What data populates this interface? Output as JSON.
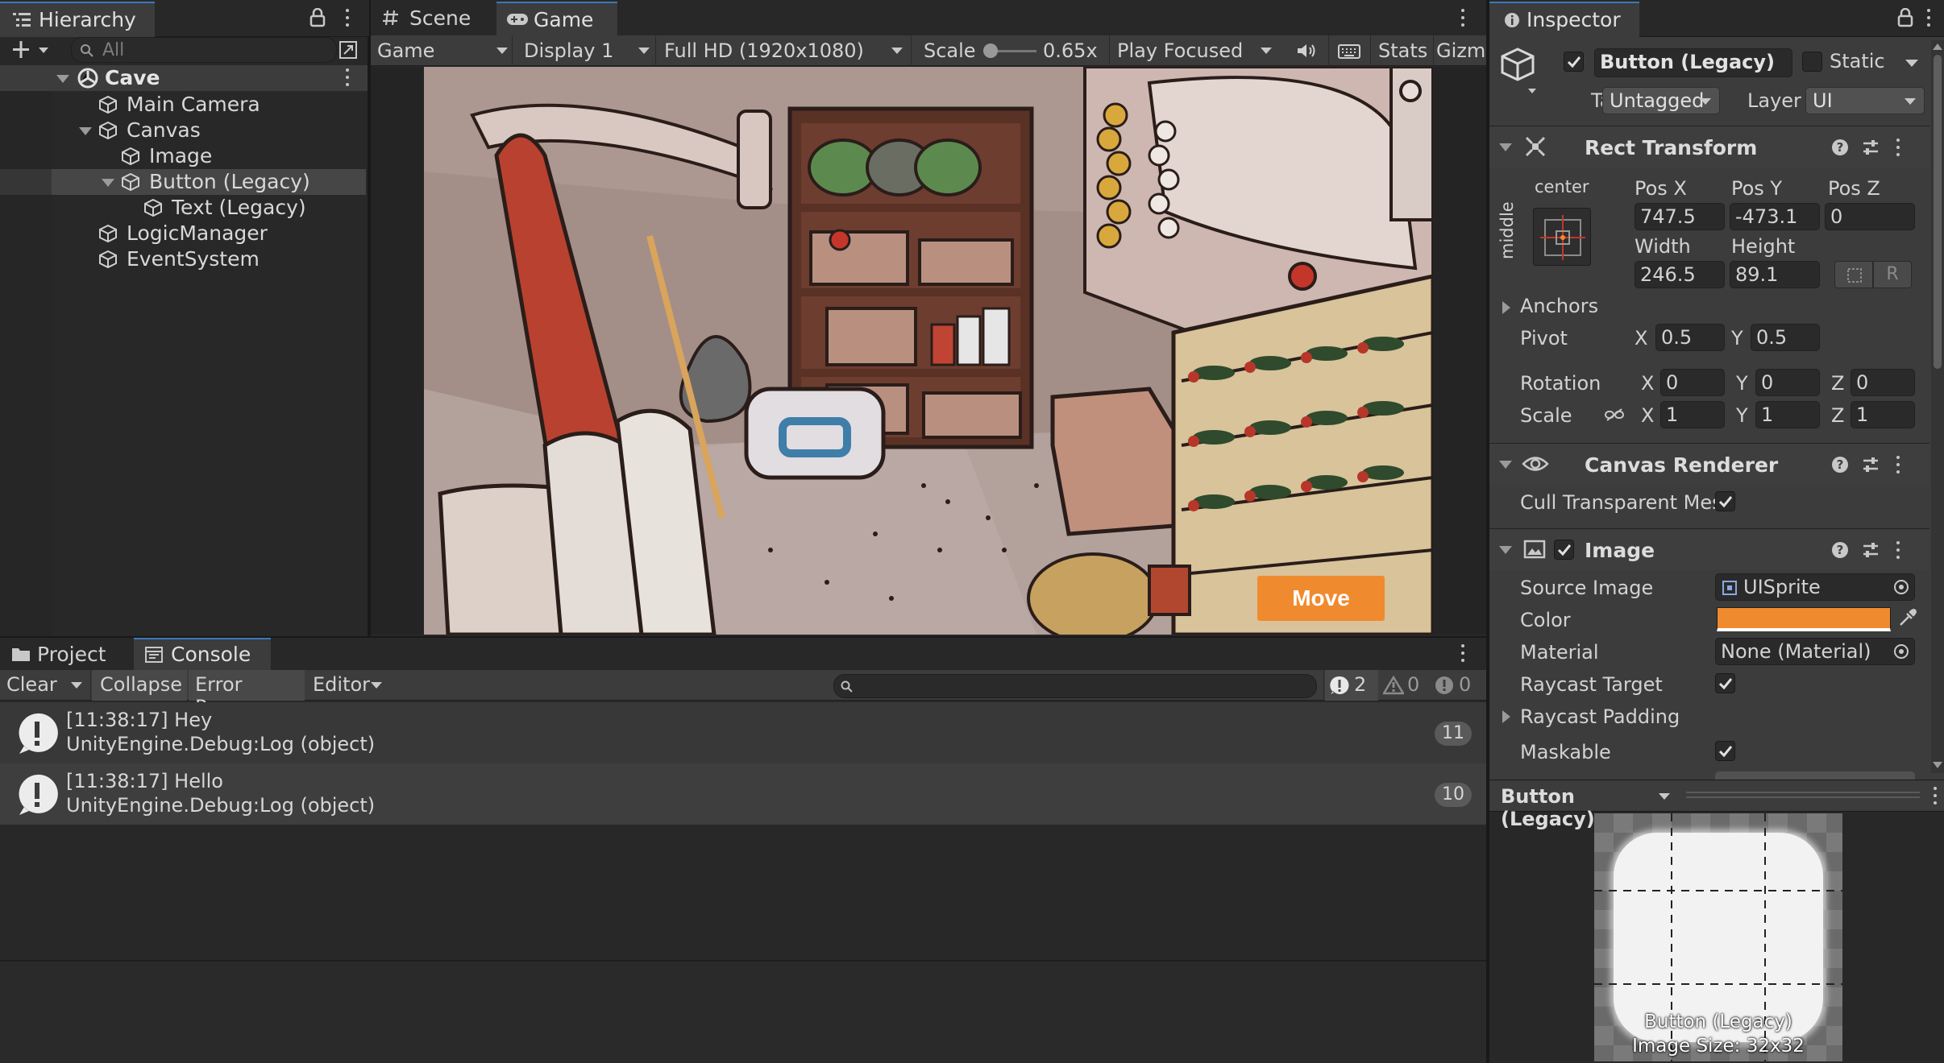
{
  "hierarchy": {
    "tab": "Hierarchy",
    "search_placeholder": "All",
    "scene": "Cave",
    "items": [
      {
        "label": "Main Camera"
      },
      {
        "label": "Canvas"
      },
      {
        "label": "Image"
      },
      {
        "label": "Button (Legacy)"
      },
      {
        "label": "Text (Legacy)"
      },
      {
        "label": "LogicManager"
      },
      {
        "label": "EventSystem"
      }
    ]
  },
  "view_tabs": {
    "scene": "Scene",
    "game": "Game"
  },
  "game_toolbar": {
    "view": "Game",
    "display": "Display 1",
    "resolution": "Full HD (1920x1080)",
    "scale_label": "Scale",
    "scale_value": "0.65x",
    "play_mode": "Play Focused",
    "stats": "Stats",
    "gizmos": "Gizm"
  },
  "game_view": {
    "button_label": "Move",
    "button_color": "#f08a2e"
  },
  "bottom_tabs": {
    "project": "Project",
    "console": "Console"
  },
  "console": {
    "clear": "Clear",
    "collapse": "Collapse",
    "error_pause": "Error Pause",
    "editor": "Editor",
    "count_info": "2",
    "count_warn": "0",
    "count_err": "0",
    "logs": [
      {
        "line1": "[11:38:17] Hey",
        "line2": "UnityEngine.Debug:Log (object)",
        "count": "11"
      },
      {
        "line1": "[11:38:17] Hello",
        "line2": "UnityEngine.Debug:Log (object)",
        "count": "10"
      }
    ]
  },
  "inspector": {
    "tab": "Inspector",
    "object_name": "Button (Legacy)",
    "static_label": "Static",
    "tag_label": "Tag",
    "tag_value": "Untagged",
    "layer_label": "Layer",
    "layer_value": "UI",
    "rect": {
      "title": "Rect Transform",
      "anchor_h": "center",
      "anchor_v": "middle",
      "pos_x_label": "Pos X",
      "pos_y_label": "Pos Y",
      "pos_z_label": "Pos Z",
      "pos_x": "747.5",
      "pos_y": "-473.1",
      "pos_z": "0",
      "width_label": "Width",
      "height_label": "Height",
      "width": "246.5",
      "height": "89.1",
      "r_btn": "R",
      "anchors": "Anchors",
      "pivot": "Pivot",
      "pivot_x": "0.5",
      "pivot_y": "0.5",
      "rotation": "Rotation",
      "rot_x": "0",
      "rot_y": "0",
      "rot_z": "0",
      "scale": "Scale",
      "scale_x": "1",
      "scale_y": "1",
      "scale_z": "1",
      "x": "X",
      "y": "Y",
      "z": "Z"
    },
    "canvas_renderer": {
      "title": "Canvas Renderer",
      "cull": "Cull Transparent Mes"
    },
    "image": {
      "title": "Image",
      "source_label": "Source Image",
      "source_value": "UISprite",
      "color_label": "Color",
      "color_value": "#f08a2e",
      "material_label": "Material",
      "material_value": "None (Material)",
      "raycast_target": "Raycast Target",
      "raycast_padding": "Raycast Padding",
      "maskable": "Maskable"
    },
    "preview": {
      "title": "Button (Legacy)",
      "caption1": "Button (Legacy)",
      "caption2": "Image Size: 32x32"
    }
  }
}
